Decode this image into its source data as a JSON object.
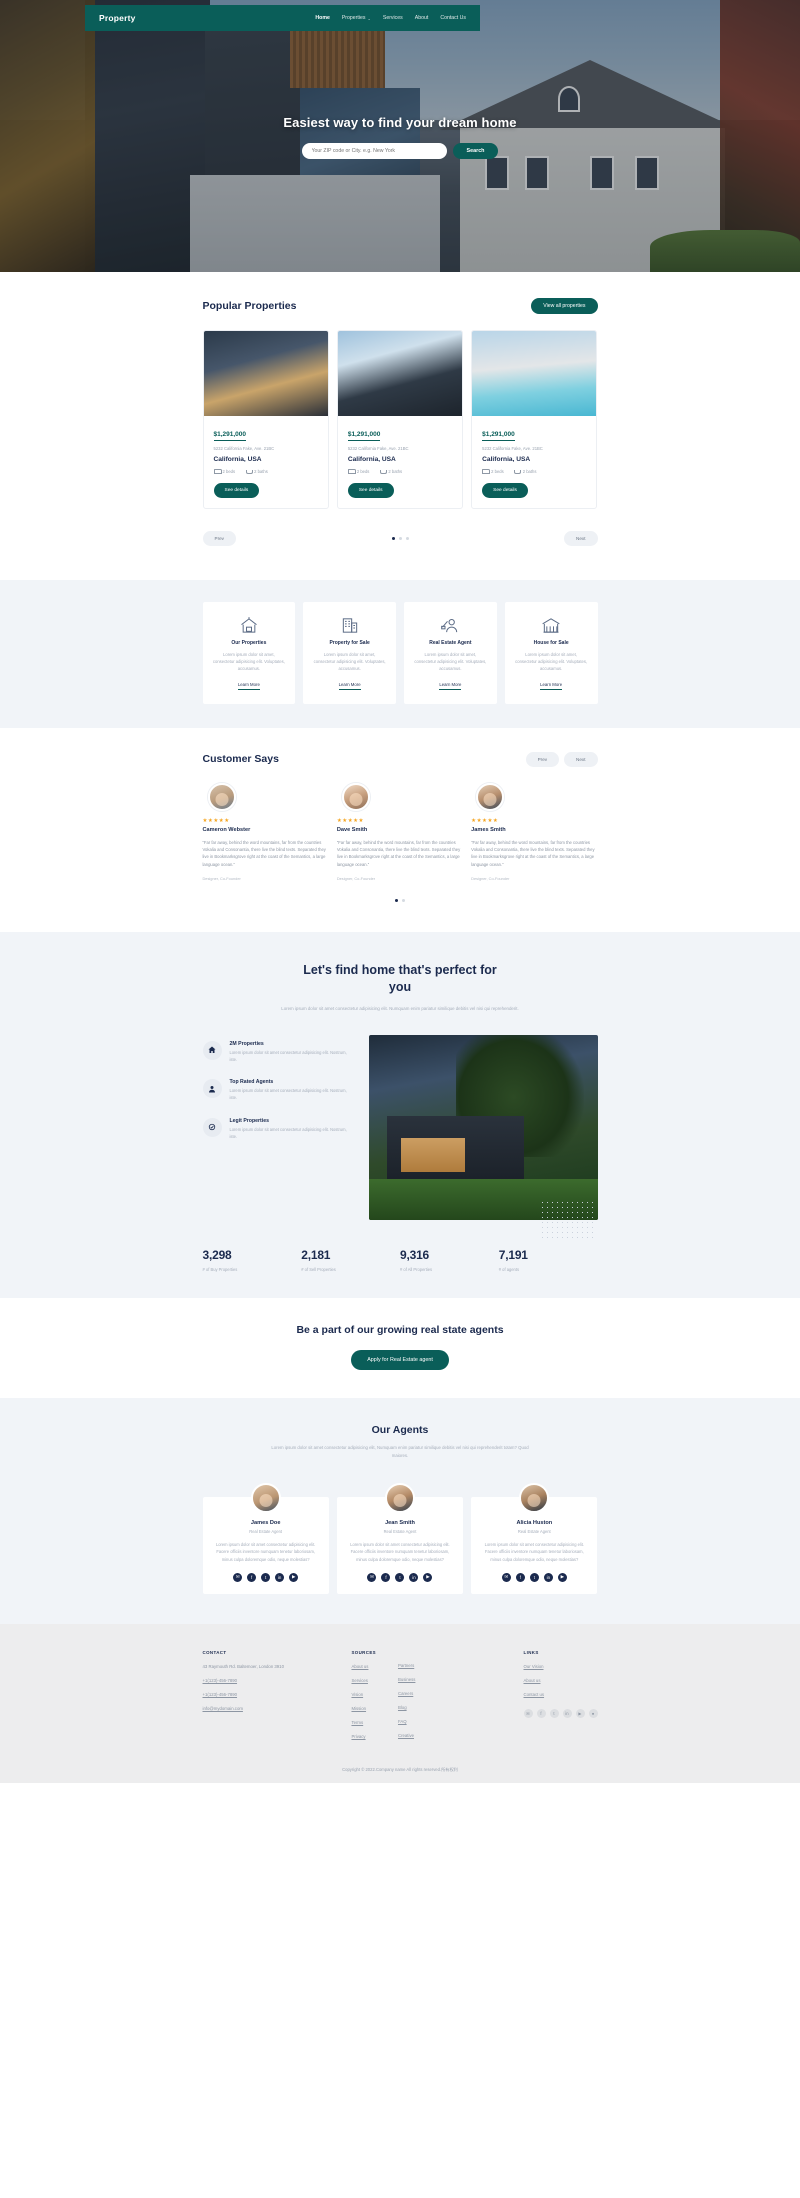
{
  "nav": {
    "brand": "Property",
    "links": [
      {
        "label": "Home",
        "active": true
      },
      {
        "label": "Properties",
        "caret": "⌄",
        "active": false
      },
      {
        "label": "Services",
        "active": false
      },
      {
        "label": "About",
        "active": false
      },
      {
        "label": "Contact Us",
        "active": false
      }
    ]
  },
  "hero": {
    "title": "Easiest way to find your dream home",
    "search_placeholder": "Your ZIP code or City. e.g. New York",
    "search_value": "",
    "search_button": "Search"
  },
  "popular": {
    "heading": "Popular Properties",
    "view_all": "View all properties",
    "prev": "Prev",
    "next": "Next",
    "cards": [
      {
        "price": "$1,291,000",
        "address": "5232 California Fake, Ave. 21BC",
        "city": "California, USA",
        "beds": "2 beds",
        "baths": "2 baths",
        "cta": "See details"
      },
      {
        "price": "$1,291,000",
        "address": "5232 California Fake, Ave. 21BC",
        "city": "California, USA",
        "beds": "2 beds",
        "baths": "2 baths",
        "cta": "See details"
      },
      {
        "price": "$1,291,000",
        "address": "5232 California Fake, Ave. 21BC",
        "city": "California, USA",
        "beds": "2 beds",
        "baths": "2 baths",
        "cta": "See details"
      }
    ]
  },
  "services": [
    {
      "icon": "house-sign-icon",
      "title": "Our Properties",
      "text": "Lorem ipsum dolor sit amet, consectetur adipisicing elit. Voluptates, accusamus.",
      "link": "Learn More"
    },
    {
      "icon": "building-icon",
      "title": "Property for Sale",
      "text": "Lorem ipsum dolor sit amet, consectetur adipisicing elit. Voluptates, accusamus.",
      "link": "Learn More"
    },
    {
      "icon": "agent-icon",
      "title": "Real Estate Agent",
      "text": "Lorem ipsum dolor sit amet, consectetur adipisicing elit. Voluptates, accusamus.",
      "link": "Learn More"
    },
    {
      "icon": "house-sale-icon",
      "title": "House for Sale",
      "text": "Lorem ipsum dolor sit amet, consectetur adipisicing elit. Voluptates, accusamus.",
      "link": "Learn More"
    }
  ],
  "testimonials": {
    "heading": "Customer Says",
    "prev": "Prev",
    "next": "Next",
    "items": [
      {
        "stars": "★★★★★",
        "name": "Cameron Webster",
        "quote": "“Far far away, behind the word mountains, far from the countries Vokalia and Consonantia, there live the blind texts. Separated they live in Bookmarksgrove right at the coast of the Semantics, a large language ocean.”",
        "role": "Designer, Co-Founder"
      },
      {
        "stars": "★★★★★",
        "name": "Dave Smith",
        "quote": "“Far far away, behind the word mountains, far from the countries Vokalia and Consonantia, there live the blind texts. Separated they live in Bookmarksgrove right at the coast of the Semantics, a large language ocean.”",
        "role": "Designer, Co-Founder"
      },
      {
        "stars": "★★★★★",
        "name": "James Smith",
        "quote": "“Far far away, behind the word mountains, far from the countries Vokalia and Consonantia, there live the blind texts. Separated they live in Bookmarksgrove right at the coast of the Semantics, a large language ocean.”",
        "role": "Designer, Co-Founder"
      }
    ]
  },
  "find": {
    "title": "Let's find home that's perfect for you",
    "subtitle": "Lorem ipsum dolor sit amet consectetur adipisicing elit. Numquam enim pariatur similique debitis vel nisi qui reprehenderit.",
    "features": [
      {
        "icon": "home-icon",
        "title": "2M Properties",
        "text": "Lorem ipsum dolor sit amet consectetur adipisicing elit. Nostrum, iste."
      },
      {
        "icon": "user-icon",
        "title": "Top Rated Agents",
        "text": "Lorem ipsum dolor sit amet consectetur adipisicing elit. Nostrum, iste."
      },
      {
        "icon": "verified-icon",
        "title": "Legit Properties",
        "text": "Lorem ipsum dolor sit amet consectetur adipisicing elit. Nostrum, iste."
      }
    ],
    "stats": [
      {
        "number": "3,298",
        "label": "# of Buy Properties"
      },
      {
        "number": "2,181",
        "label": "# of Sell Properties"
      },
      {
        "number": "9,316",
        "label": "# of All Properties"
      },
      {
        "number": "7,191",
        "label": "# of agents"
      }
    ]
  },
  "cta": {
    "title": "Be a part of our growing real state agents",
    "button": "Apply for Real Estate agent"
  },
  "agents": {
    "heading": "Our Agents",
    "subtitle": "Lorem ipsum dolor sit amet consectetur adipisicing elit, Numquam enim pariatur similique debitis vel nisi qui reprehenderit totam? Quod maiores.",
    "items": [
      {
        "name": "James Doe",
        "role": "Real Estate Agent",
        "text": "Lorem ipsum dolor sit amet consectetur adipisicing elit. Facere officiis inventore numquam tenetur laboriosam, minus culpa doloremque odio, neque molestias?",
        "socials": [
          "✉",
          "f",
          "t",
          "in",
          "▶"
        ]
      },
      {
        "name": "Jean Smith",
        "role": "Real Estate Agent",
        "text": "Lorem ipsum dolor sit amet consectetur adipisicing elit. Facere officiis inventore numquam tenetur laboriosam, minus culpa doloremque odio, neque molestias?",
        "socials": [
          "✉",
          "f",
          "t",
          "in",
          "▶"
        ]
      },
      {
        "name": "Alicia Huston",
        "role": "Real Estate Agent",
        "text": "Lorem ipsum dolor sit amet consectetur adipisicing elit. Facere officiis inventore numquam tenetur laboriosam, minus culpa doloremque odio, neque molestias?",
        "socials": [
          "✉",
          "f",
          "t",
          "in",
          "▶"
        ]
      }
    ]
  },
  "footer": {
    "contact": {
      "heading": "CONTACT",
      "address": "43 Raymouth Rd. Baltemoer, London 3910",
      "phone1": "+1(123)-456-7890",
      "phone2": "+1(123)-456-7890",
      "email": "info@mydomain.com"
    },
    "sources": {
      "heading": "SOURCES",
      "col1": [
        "About us",
        "Services",
        "Vision",
        "Mission",
        "Terms",
        "Privacy"
      ],
      "col2": [
        "Partners",
        "Business",
        "Careers",
        "Blog",
        "FAQ",
        "Creative"
      ]
    },
    "links": {
      "heading": "LINKS",
      "items": [
        "Our Vision",
        "About us",
        "Contact us"
      ],
      "socials": [
        "✉",
        "f",
        "t",
        "in",
        "▶",
        "●"
      ]
    },
    "copyright": "Copyright © 2022.Company name All rights reserved.所有权利"
  }
}
